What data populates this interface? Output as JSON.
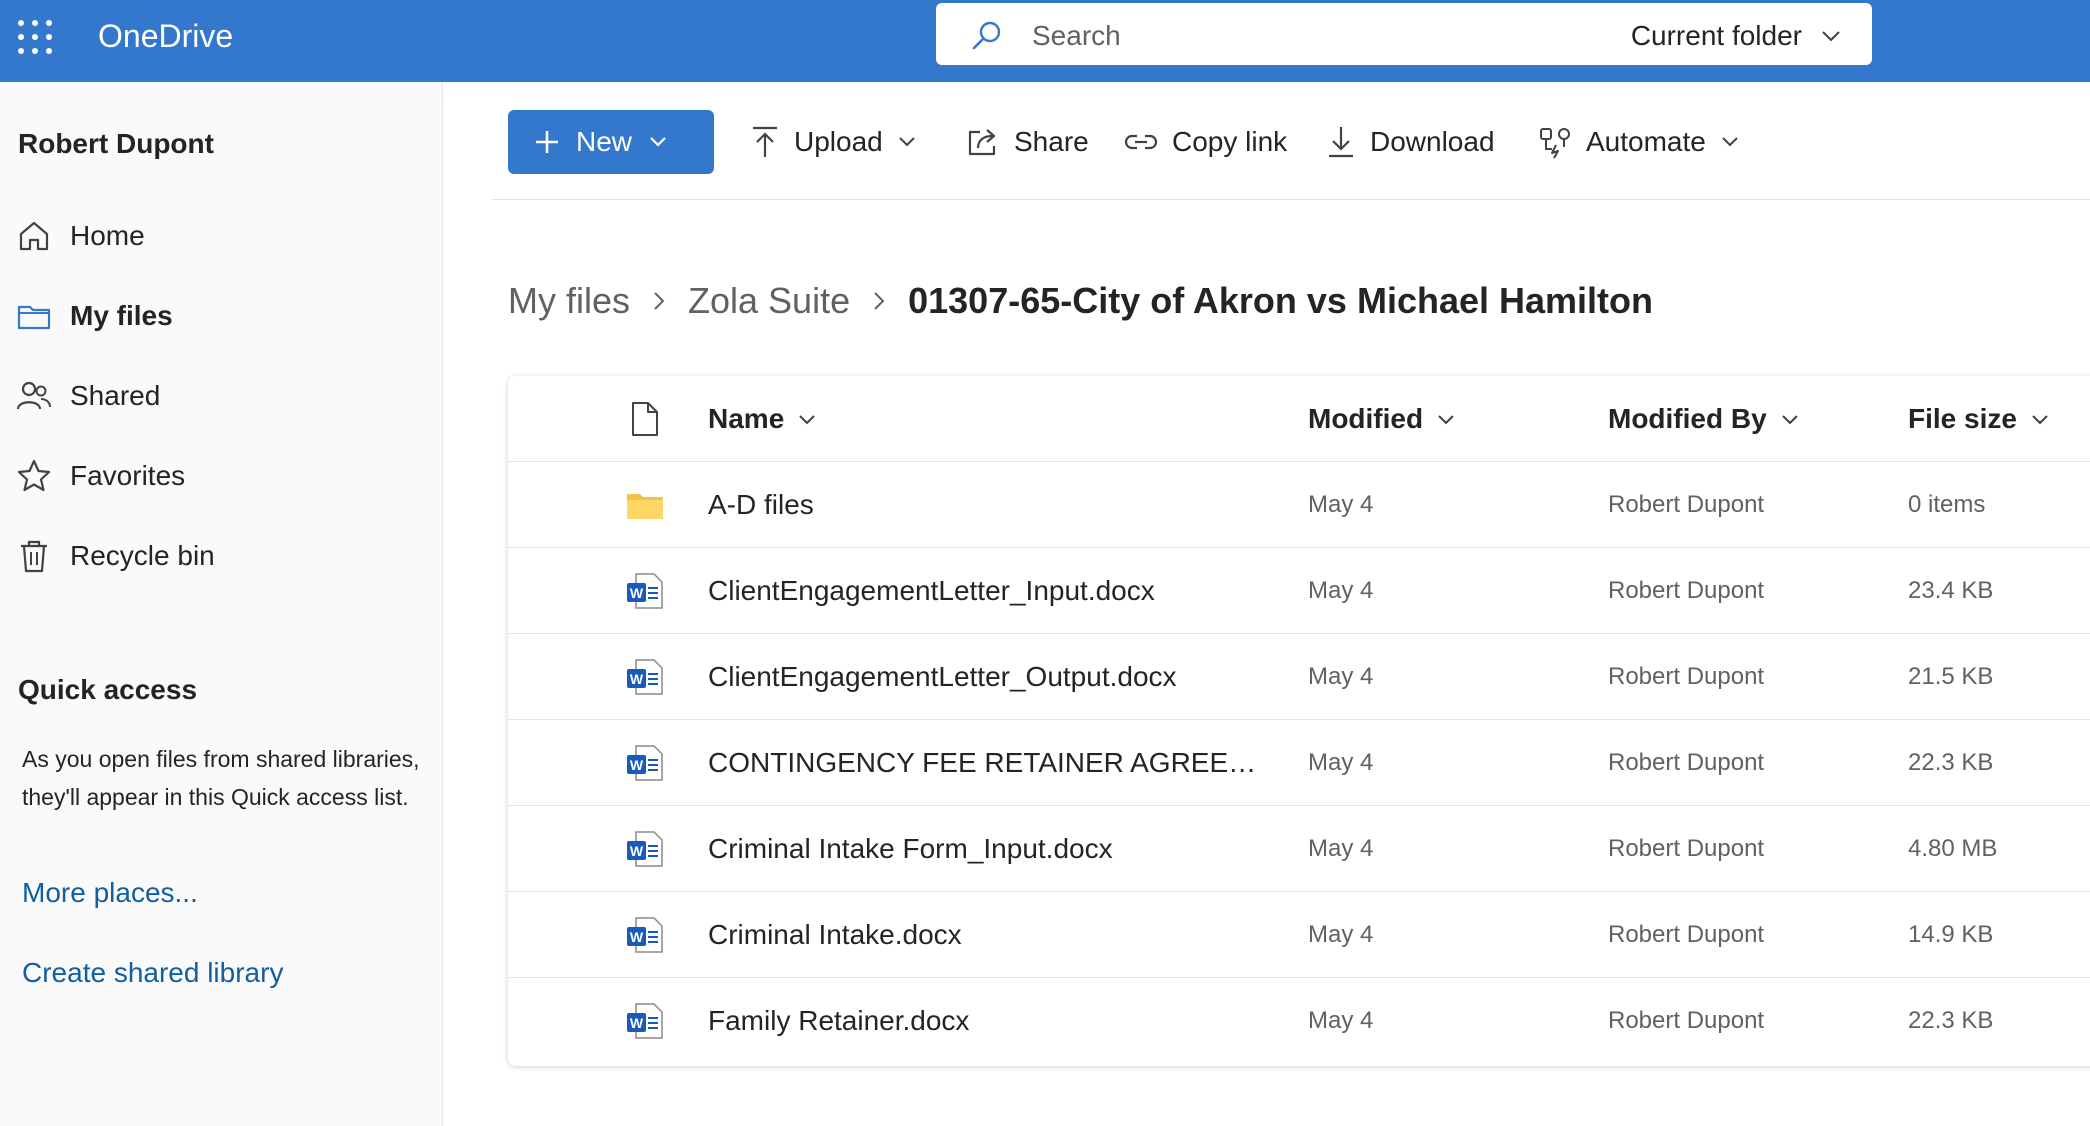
{
  "app": {
    "title": "OneDrive"
  },
  "search": {
    "placeholder": "Search",
    "scope": "Current folder"
  },
  "sidebar": {
    "user": "Robert Dupont",
    "items": [
      {
        "label": "Home",
        "icon": "home-icon"
      },
      {
        "label": "My files",
        "icon": "folder-icon",
        "active": true
      },
      {
        "label": "Shared",
        "icon": "people-icon"
      },
      {
        "label": "Favorites",
        "icon": "star-icon"
      },
      {
        "label": "Recycle bin",
        "icon": "trash-icon"
      }
    ],
    "quick_access": {
      "title": "Quick access",
      "description": "As you open files from shared libraries, they'll appear in this Quick access list.",
      "more_places": "More places...",
      "create_library": "Create shared library"
    }
  },
  "toolbar": {
    "new": "New",
    "upload": "Upload",
    "share": "Share",
    "copy_link": "Copy link",
    "download": "Download",
    "automate": "Automate"
  },
  "breadcrumb": {
    "items": [
      "My files",
      "Zola Suite"
    ],
    "current": "01307-65-City of Akron vs Michael Hamilton"
  },
  "file_list": {
    "columns": {
      "name": "Name",
      "modified": "Modified",
      "modified_by": "Modified By",
      "file_size": "File size"
    },
    "rows": [
      {
        "name": "A-D files",
        "type": "folder",
        "modified": "May 4",
        "modified_by": "Robert Dupont",
        "size": "0 items"
      },
      {
        "name": "ClientEngagementLetter_Input.docx",
        "type": "word",
        "modified": "May 4",
        "modified_by": "Robert Dupont",
        "size": "23.4 KB"
      },
      {
        "name": "ClientEngagementLetter_Output.docx",
        "type": "word",
        "modified": "May 4",
        "modified_by": "Robert Dupont",
        "size": "21.5 KB"
      },
      {
        "name": "CONTINGENCY FEE RETAINER AGREEMENT...",
        "type": "word",
        "modified": "May 4",
        "modified_by": "Robert Dupont",
        "size": "22.3 KB"
      },
      {
        "name": "Criminal Intake Form_Input.docx",
        "type": "word",
        "modified": "May 4",
        "modified_by": "Robert Dupont",
        "size": "4.80 MB"
      },
      {
        "name": "Criminal Intake.docx",
        "type": "word",
        "modified": "May 4",
        "modified_by": "Robert Dupont",
        "size": "14.9 KB"
      },
      {
        "name": "Family Retainer.docx",
        "type": "word",
        "modified": "May 4",
        "modified_by": "Robert Dupont",
        "size": "22.3 KB"
      }
    ]
  },
  "colors": {
    "brand": "#3478cd",
    "link": "#115ea3",
    "folder": "#f5c242",
    "word": "#185abd"
  }
}
